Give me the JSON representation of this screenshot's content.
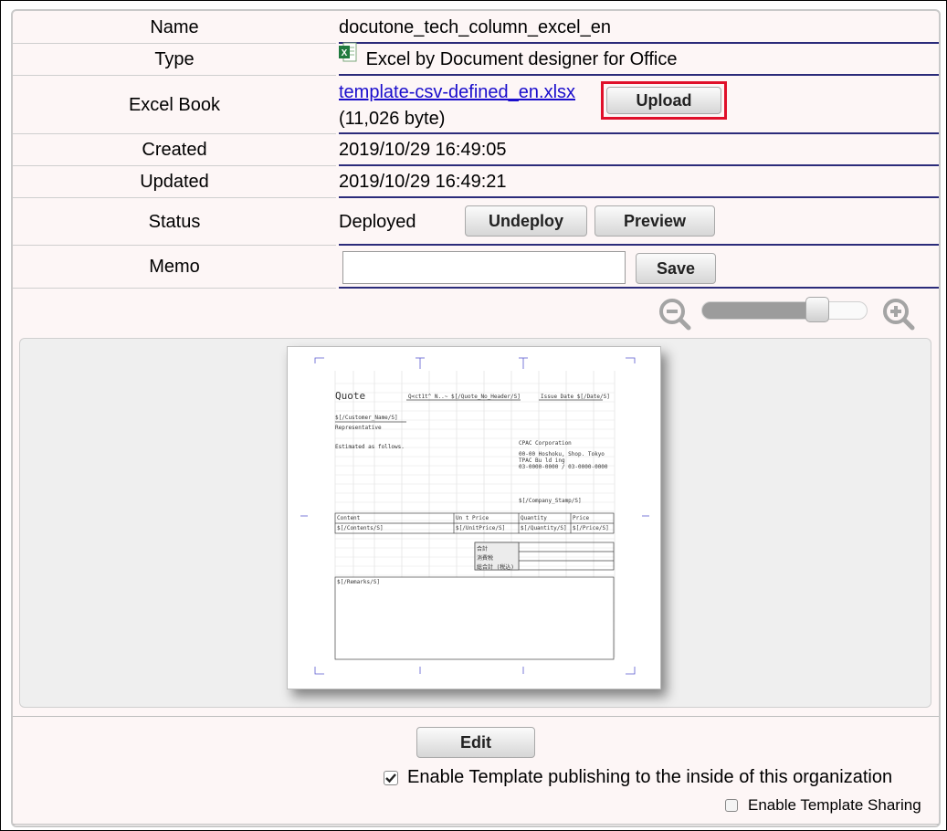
{
  "rows": {
    "name": {
      "label": "Name",
      "value": "docutone_tech_column_excel_en"
    },
    "type": {
      "label": "Type",
      "value": "Excel by Document designer for Office",
      "icon": "excel-icon"
    },
    "excel_book": {
      "label": "Excel Book",
      "file_link": "template-csv-defined_en.xlsx",
      "size": "(11,026 byte)",
      "upload_label": "Upload"
    },
    "created": {
      "label": "Created",
      "value": "2019/10/29 16:49:05"
    },
    "updated": {
      "label": "Updated",
      "value": "2019/10/29 16:49:21"
    },
    "status": {
      "label": "Status",
      "value": "Deployed",
      "undeploy_label": "Undeploy",
      "preview_label": "Preview"
    },
    "memo": {
      "label": "Memo",
      "input_value": "",
      "save_label": "Save"
    }
  },
  "zoom": {
    "zoom_out_icon": "zoom-out-icon",
    "zoom_in_icon": "zoom-in-icon",
    "level": 0.7
  },
  "sheet": {
    "title": "Quote",
    "field_quote_no": "Q<ct1t^ N..~ $[/Quote_No_Header/S]",
    "field_issue_date": "Issue Date $[/Date/S]",
    "customer": "$[/Customer_Name/S]",
    "representative": "Representative",
    "estimated": "Estimated as follows.",
    "company_1": "CPAC Corporation",
    "company_2": "00-00 Hoshoku, Shop. Tokyo",
    "company_3": "TPAC Bu ld ing",
    "company_4": "03-0000-0000 / 03-0000-0000",
    "company_stamp": "$[/Company_Stamp/S]",
    "col_content": "Content",
    "col_unit_price": "Un t Price",
    "col_quantity": "Quantity",
    "col_price": "Price",
    "cell_content": "$[/Contents/S]",
    "cell_unit": "$[/UnitPrice/S]",
    "cell_qty": "$[/Quantity/S]",
    "cell_price": "$[/Price/S]",
    "sum_1": "合計",
    "sum_2": "消費税",
    "sum_3": "総合計 (税込)",
    "remarks": "$[/Remarks/S]"
  },
  "footer": {
    "edit_label": "Edit",
    "publish_label": "Enable Template publishing to the inside of this organization",
    "publish_checked": true,
    "sharing_label": "Enable Template Sharing",
    "sharing_checked": false
  }
}
